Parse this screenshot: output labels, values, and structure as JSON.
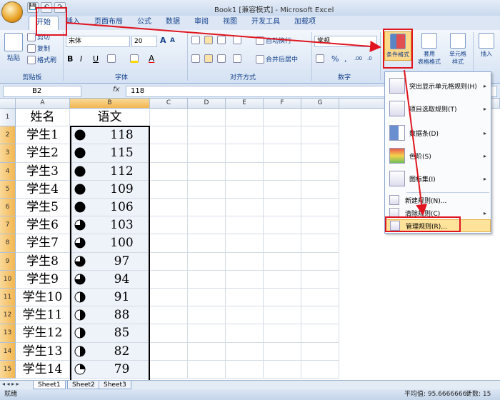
{
  "window": {
    "title": "Book1  [兼容模式] - Microsoft Excel"
  },
  "qat": {
    "save": "💾",
    "undo": "↶",
    "redo": "↷"
  },
  "tabs": [
    "开始",
    "插入",
    "页面布局",
    "公式",
    "数据",
    "审阅",
    "视图",
    "开发工具",
    "加载项"
  ],
  "ribbon": {
    "clipboard": {
      "paste": "粘贴",
      "cut": "剪切",
      "copy": "复制",
      "format_painter": "格式刷",
      "label": "剪贴板"
    },
    "font": {
      "name": "宋体",
      "size": "20",
      "grow": "A",
      "shrink": "A",
      "bold": "B",
      "italic": "I",
      "underline": "U",
      "label": "字体"
    },
    "alignment": {
      "wrap": "自动换行",
      "merge": "合并后居中",
      "label": "对齐方式"
    },
    "number": {
      "format": "常规",
      "currency": "%",
      "comma": ",",
      "inc": ".00",
      "dec": ".0",
      "label": "数字"
    },
    "styles": {
      "cond_format": "条件格式",
      "table_format": "套用\n表格格式",
      "cell_styles": "单元格\n样式",
      "label": "样式"
    },
    "cells": {
      "insert": "插入"
    }
  },
  "formula_bar": {
    "name_box": "B2",
    "fx": "fx",
    "value": "118"
  },
  "columns": [
    "A",
    "B",
    "C",
    "D",
    "E",
    "F",
    "G"
  ],
  "rows": [
    {
      "num": "1",
      "a": "姓名",
      "b": "语文",
      "quarters": null
    },
    {
      "num": "2",
      "a": "学生1",
      "b": "118",
      "quarters": 4
    },
    {
      "num": "3",
      "a": "学生2",
      "b": "115",
      "quarters": 4
    },
    {
      "num": "4",
      "a": "学生3",
      "b": "112",
      "quarters": 4
    },
    {
      "num": "5",
      "a": "学生4",
      "b": "109",
      "quarters": 4
    },
    {
      "num": "6",
      "a": "学生5",
      "b": "106",
      "quarters": 4
    },
    {
      "num": "7",
      "a": "学生6",
      "b": "103",
      "quarters": 3
    },
    {
      "num": "8",
      "a": "学生7",
      "b": "100",
      "quarters": 3
    },
    {
      "num": "9",
      "a": "学生8",
      "b": "97",
      "quarters": 3
    },
    {
      "num": "10",
      "a": "学生9",
      "b": "94",
      "quarters": 3
    },
    {
      "num": "11",
      "a": "学生10",
      "b": "91",
      "quarters": 2
    },
    {
      "num": "12",
      "a": "学生11",
      "b": "88",
      "quarters": 2
    },
    {
      "num": "13",
      "a": "学生12",
      "b": "85",
      "quarters": 2
    },
    {
      "num": "14",
      "a": "学生13",
      "b": "82",
      "quarters": 2
    },
    {
      "num": "15",
      "a": "学生14",
      "b": "79",
      "quarters": 1
    }
  ],
  "menu": {
    "items": [
      {
        "label": "突出显示单元格规则(H)",
        "arrow": "▸"
      },
      {
        "label": "项目选取规则(T)",
        "arrow": "▸"
      },
      {
        "label": "数据条(D)",
        "arrow": "▸"
      },
      {
        "label": "色阶(S)",
        "arrow": "▸"
      },
      {
        "label": "图标集(I)",
        "arrow": "▸"
      },
      {
        "label": "新建规则(N)...",
        "arrow": ""
      },
      {
        "label": "清除规则(C)",
        "arrow": "▸"
      },
      {
        "label": "管理规则(R)...",
        "arrow": ""
      }
    ]
  },
  "sheets": [
    "Sheet1",
    "Sheet2",
    "Sheet3"
  ],
  "status": {
    "ready": "就绪",
    "average": "平均值: 95.66666667",
    "count": "计数: 15"
  }
}
